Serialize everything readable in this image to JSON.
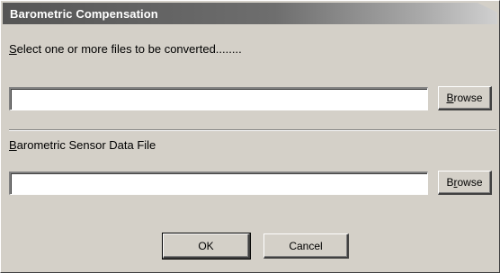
{
  "window": {
    "title": "Barometric Compensation"
  },
  "files_section": {
    "label_hotkey": "S",
    "label_rest": "elect one or more files to be converted........",
    "input_value": "",
    "browse_hotkey": "B",
    "browse_rest": "rowse"
  },
  "sensor_section": {
    "label_hotkey": "B",
    "label_rest": "arometric Sensor Data File",
    "input_value": "",
    "browse_pre": "B",
    "browse_hotkey": "r",
    "browse_rest": "owse"
  },
  "buttons": {
    "ok_label": "OK",
    "cancel_label": "Cancel"
  },
  "colors": {
    "dialog_face": "#d4d0c8",
    "titlebar_dark": "#555555",
    "title_text": "#ffffff"
  }
}
